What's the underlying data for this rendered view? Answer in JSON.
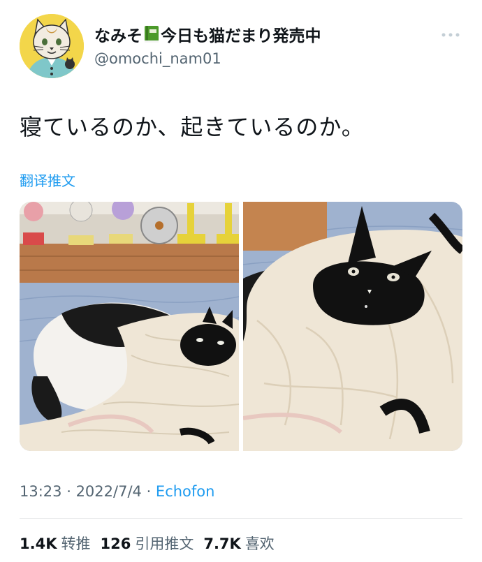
{
  "user": {
    "display_name_part1": "なみそ",
    "display_name_part2": "今日も猫だまり発売中",
    "handle": "@omochi_nam01",
    "avatar_icon": "cat-avatar-icon",
    "emoji_icon": "green-book-icon"
  },
  "tweet": {
    "text": "寝ているのか、起きているのか。",
    "translate_label": "翻译推文"
  },
  "media": {
    "photos": [
      {
        "name": "cat-on-blanket-photo-left"
      },
      {
        "name": "cat-on-blanket-photo-right"
      }
    ]
  },
  "meta": {
    "time": "13:23",
    "date": "2022/7/4",
    "source": "Echofon",
    "separator": " · "
  },
  "stats": [
    {
      "value": "1.4K",
      "label": "转推"
    },
    {
      "value": "126",
      "label": "引用推文"
    },
    {
      "value": "7.7K",
      "label": "喜欢"
    }
  ],
  "colors": {
    "link": "#1d9bf0",
    "secondary_text": "#536471",
    "primary_text": "#0f1419"
  }
}
